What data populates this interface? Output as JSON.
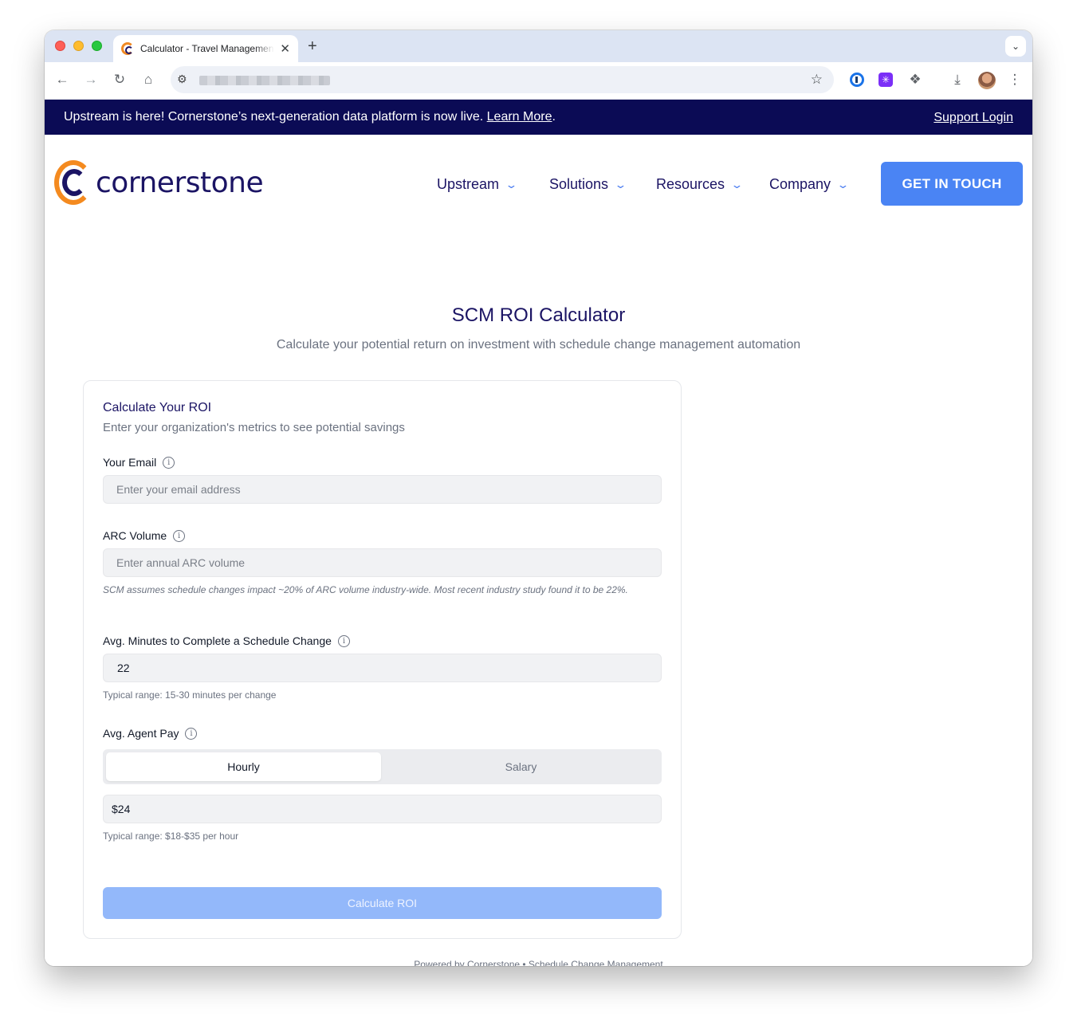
{
  "browser": {
    "tab_title": "Calculator - Travel Management",
    "new_tab_symbol": "+",
    "tab_close_symbol": "✕",
    "tab_menu_symbol": "⌄",
    "extension_purple_symbol": "✳"
  },
  "banner": {
    "text": "Upstream is here! Cornerstone’s next-generation data platform is now live.",
    "link": "Learn More",
    "period": ".",
    "support_login": "Support Login",
    "background": "#0b0b55"
  },
  "header": {
    "logo_text": "cornerstone",
    "nav": [
      {
        "label": "Upstream"
      },
      {
        "label": "Solutions"
      },
      {
        "label": "Resources"
      },
      {
        "label": "Company"
      }
    ],
    "chevron": "⌄",
    "cta": "GET IN TOUCH",
    "brand_orange": "#f48a1f",
    "brand_navy": "#1b1464",
    "accent_blue": "#4a84f4"
  },
  "main": {
    "title": "SCM ROI Calculator",
    "subtitle": "Calculate your potential return on investment with schedule change management automation"
  },
  "card": {
    "title": "Calculate Your ROI",
    "description": "Enter your organization's metrics to see potential savings",
    "info_symbol": "i",
    "email": {
      "label": "Your Email",
      "placeholder": "Enter your email address"
    },
    "arc": {
      "label": "ARC Volume",
      "placeholder": "Enter annual ARC volume",
      "note": "SCM assumes schedule changes impact ~20% of ARC volume industry-wide. Most recent industry study found it to be 22%."
    },
    "minutes": {
      "label": "Avg. Minutes to Complete a Schedule Change",
      "value": "22",
      "hint": "Typical range: 15-30 minutes per change"
    },
    "pay": {
      "label": "Avg. Agent Pay",
      "options": [
        "Hourly",
        "Salary"
      ],
      "selected": "Hourly",
      "value": "$24",
      "hint": "Typical range: $18-$35 per hour"
    },
    "submit": "Calculate ROI"
  },
  "footer": {
    "text": "Powered by Cornerstone • Schedule Change Management"
  }
}
